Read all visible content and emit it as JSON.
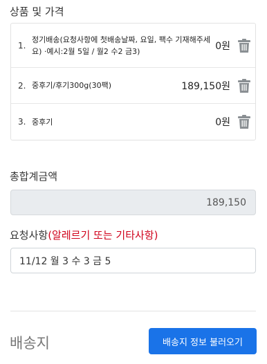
{
  "products": {
    "title": "상품 및 가격",
    "items": [
      {
        "num": "1.",
        "name": "정기배송(요청사항에 첫배송날짜, 요일, 팩수 기재해주세요) ·예시:2월 5일 / 월2 수2 금3)",
        "price": "0원"
      },
      {
        "num": "2.",
        "name": "중후기/후기300g(30팩)",
        "price": "189,150원"
      },
      {
        "num": "3.",
        "name": "중후기",
        "price": "0원"
      }
    ]
  },
  "total": {
    "label": "총합계금액",
    "value": "189,150"
  },
  "memo": {
    "label": "요청사항",
    "hint": "(알레르기 또는 기타사항)",
    "value": "11/12 월 3 수 3 금 5"
  },
  "shipping": {
    "title": "배송지",
    "button_label": "배송지 정보 불러오기"
  },
  "colors": {
    "accent": "#1a73e8",
    "hint_red": "#d0021b",
    "trash_gray": "#8a8f93"
  },
  "icons": {
    "delete": "trash-icon"
  }
}
